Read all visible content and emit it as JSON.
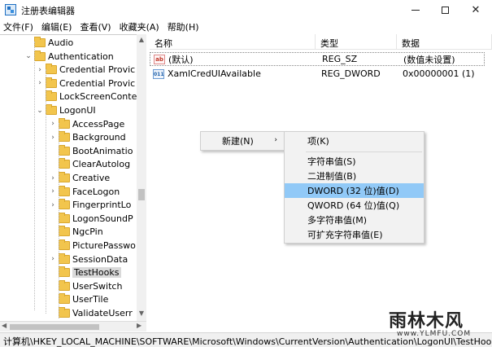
{
  "window": {
    "title": "注册表编辑器"
  },
  "menu": [
    "文件(F)",
    "编辑(E)",
    "查看(V)",
    "收藏夹(A)",
    "帮助(H)"
  ],
  "tree": [
    {
      "label": "Audio",
      "chevron": "",
      "level": 1
    },
    {
      "label": "Authentication",
      "chevron": "⌄",
      "level": 1
    },
    {
      "label": "Credential Provic",
      "chevron": "›",
      "level": 2
    },
    {
      "label": "Credential Provic",
      "chevron": "›",
      "level": 2
    },
    {
      "label": "LockScreenConte",
      "chevron": "",
      "level": 2
    },
    {
      "label": "LogonUI",
      "chevron": "⌄",
      "level": 2
    },
    {
      "label": "AccessPage",
      "chevron": "›",
      "level": 3
    },
    {
      "label": "Background",
      "chevron": "›",
      "level": 3
    },
    {
      "label": "BootAnimatio",
      "chevron": "",
      "level": 3
    },
    {
      "label": "ClearAutolog",
      "chevron": "",
      "level": 3
    },
    {
      "label": "Creative",
      "chevron": "›",
      "level": 3
    },
    {
      "label": "FaceLogon",
      "chevron": "›",
      "level": 3
    },
    {
      "label": "FingerprintLo",
      "chevron": "›",
      "level": 3
    },
    {
      "label": "LogonSoundP",
      "chevron": "",
      "level": 3
    },
    {
      "label": "NgcPin",
      "chevron": "",
      "level": 3
    },
    {
      "label": "PicturePasswo",
      "chevron": "",
      "level": 3
    },
    {
      "label": "SessionData",
      "chevron": "›",
      "level": 3
    },
    {
      "label": "TestHooks",
      "chevron": "",
      "level": 3,
      "selected": true
    },
    {
      "label": "UserSwitch",
      "chevron": "",
      "level": 3
    },
    {
      "label": "UserTile",
      "chevron": "",
      "level": 3
    },
    {
      "label": "ValidateUserr",
      "chevron": "",
      "level": 3
    }
  ],
  "columns": {
    "name": "名称",
    "type": "类型",
    "data": "数据"
  },
  "values": [
    {
      "icon": "ab",
      "icon_text": "ab",
      "name": "(默认)",
      "type": "REG_SZ",
      "data": "(数值未设置)",
      "focused": true
    },
    {
      "icon": "bin",
      "icon_text": "011",
      "name": "XamlCredUIAvailable",
      "type": "REG_DWORD",
      "data": "0x00000001 (1)"
    }
  ],
  "context_menu": {
    "new_label": "新建(N)",
    "new_arrow": "›",
    "submenu": {
      "key": "项(K)",
      "items": [
        {
          "label": "字符串值(S)"
        },
        {
          "label": "二进制值(B)"
        },
        {
          "label": "DWORD (32 位)值(D)",
          "highlighted": true
        },
        {
          "label": "QWORD (64 位)值(Q)"
        },
        {
          "label": "多字符串值(M)"
        },
        {
          "label": "可扩充字符串值(E)"
        }
      ]
    }
  },
  "status": "计算机\\HKEY_LOCAL_MACHINE\\SOFTWARE\\Microsoft\\Windows\\CurrentVersion\\Authentication\\LogonUI\\TestHooks",
  "watermark": {
    "main": "雨林木风",
    "sub": "www.YLMFU.COM"
  }
}
